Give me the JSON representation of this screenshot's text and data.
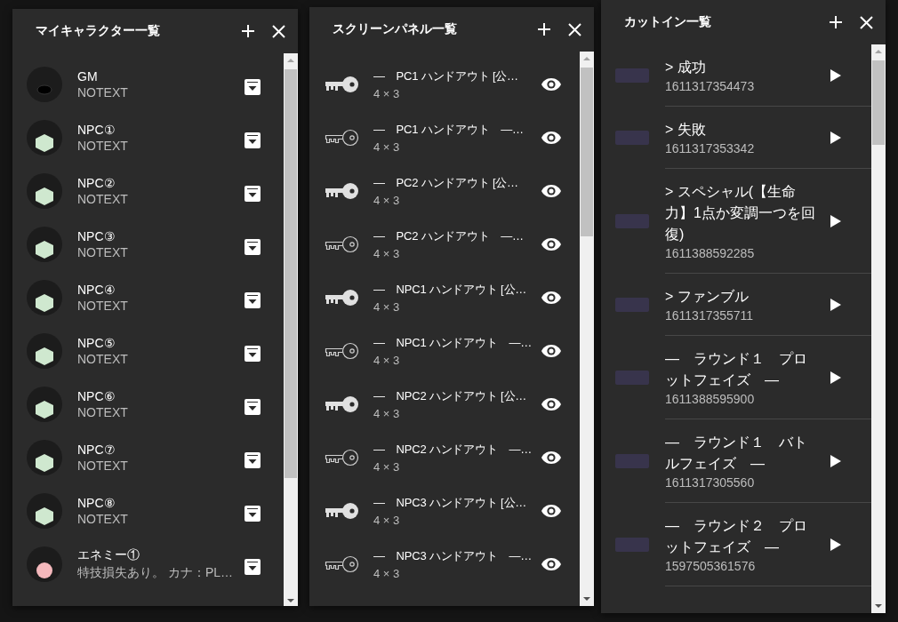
{
  "character_panel": {
    "title": "マイキャラクター一覧",
    "characters": [
      {
        "kind": "gm",
        "name": "GM",
        "note": "NOTEXT"
      },
      {
        "kind": "npc",
        "name": "NPC①",
        "note": "NOTEXT"
      },
      {
        "kind": "npc",
        "name": "NPC②",
        "note": "NOTEXT"
      },
      {
        "kind": "npc",
        "name": "NPC③",
        "note": "NOTEXT"
      },
      {
        "kind": "npc",
        "name": "NPC④",
        "note": "NOTEXT"
      },
      {
        "kind": "npc",
        "name": "NPC⑤",
        "note": "NOTEXT"
      },
      {
        "kind": "npc",
        "name": "NPC⑥",
        "note": "NOTEXT"
      },
      {
        "kind": "npc",
        "name": "NPC⑦",
        "note": "NOTEXT"
      },
      {
        "kind": "npc",
        "name": "NPC⑧",
        "note": "NOTEXT"
      },
      {
        "kind": "enemy",
        "name": "エネミー①",
        "note": "特技損失あり。 カナ：PL…"
      }
    ]
  },
  "screen_panel": {
    "title": "スクリーンパネル一覧",
    "panels": [
      {
        "name": "—　PC1 ハンドアウト [公…",
        "size": "4 × 3",
        "filled_key": true
      },
      {
        "name": "—　PC1 ハンドアウト　—…",
        "size": "4 × 3",
        "filled_key": false
      },
      {
        "name": "—　PC2 ハンドアウト [公…",
        "size": "4 × 3",
        "filled_key": true
      },
      {
        "name": "—　PC2 ハンドアウト　—…",
        "size": "4 × 3",
        "filled_key": false
      },
      {
        "name": "—　NPC1 ハンドアウト [公…",
        "size": "4 × 3",
        "filled_key": true
      },
      {
        "name": "—　NPC1 ハンドアウト　—…",
        "size": "4 × 3",
        "filled_key": false
      },
      {
        "name": "—　NPC2 ハンドアウト [公…",
        "size": "4 × 3",
        "filled_key": true
      },
      {
        "name": "—　NPC2 ハンドアウト　—…",
        "size": "4 × 3",
        "filled_key": false
      },
      {
        "name": "—　NPC3 ハンドアウト [公…",
        "size": "4 × 3",
        "filled_key": true
      },
      {
        "name": "—　NPC3 ハンドアウト　—…",
        "size": "4 × 3",
        "filled_key": false
      }
    ]
  },
  "cutin_panel": {
    "title": "カットイン一覧",
    "cutins": [
      {
        "title": "> 成功",
        "id": "1611317354473"
      },
      {
        "title": "> 失敗",
        "id": "1611317353342"
      },
      {
        "title": "> スペシャル(【生命力】1点か変調一つを回復)",
        "id": "1611388592285"
      },
      {
        "title": "> ファンブル",
        "id": "1611317355711"
      },
      {
        "title": "—　ラウンド１　プロットフェイズ　—",
        "id": "1611388595900"
      },
      {
        "title": "—　ラウンド１　バトルフェイズ　—",
        "id": "1611317305560"
      },
      {
        "title": "—　ラウンド２　プロットフェイズ　—",
        "id": "1597505361576"
      }
    ]
  }
}
